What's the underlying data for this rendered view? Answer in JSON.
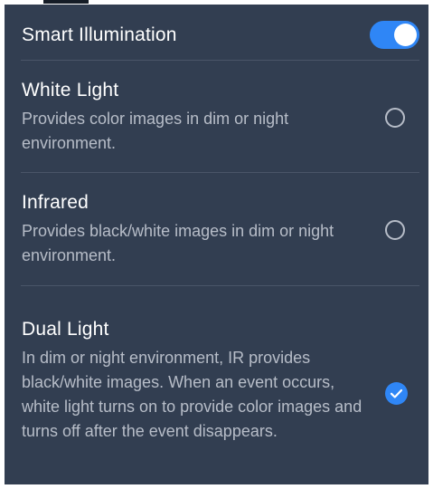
{
  "header": {
    "master_label": "Smart Illumination",
    "master_toggle_on": true
  },
  "options": [
    {
      "title": "White Light",
      "description": "Provides color images in dim or night environment.",
      "selected": false
    },
    {
      "title": "Infrared",
      "description": "Provides black/white images in dim or night environment.",
      "selected": false
    },
    {
      "title": "Dual Light",
      "description": "In dim or night environment, IR provides black/white images. When an event occurs, white light turns on to provide color images and turns off after the event disappears.",
      "selected": true
    }
  ],
  "colors": {
    "panel_background": "#323e51",
    "accent": "#2f86f6",
    "primary_text": "#ffffff",
    "secondary_text": "#b7bdc8"
  }
}
